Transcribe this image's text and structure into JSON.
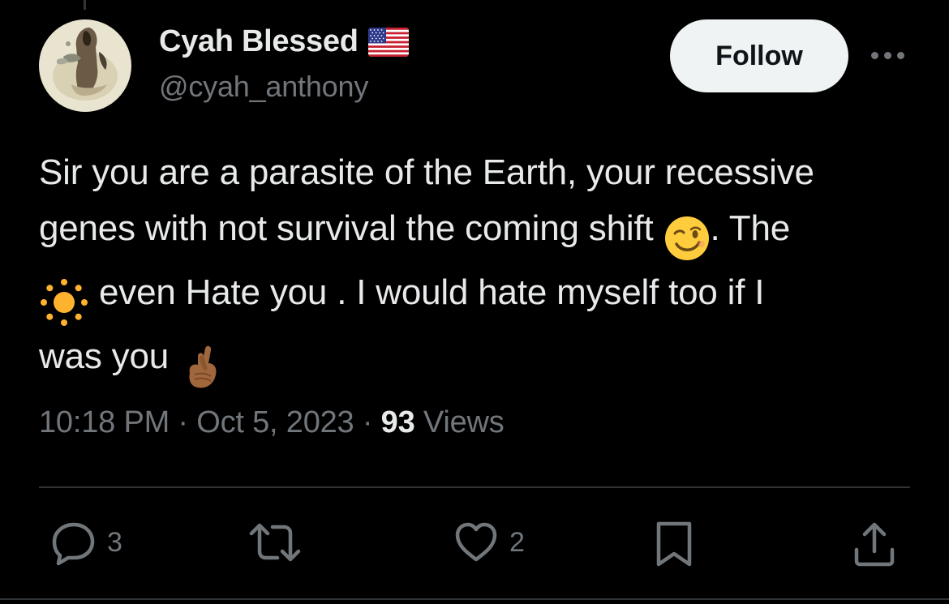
{
  "author": {
    "display_name": "Cyah Blessed",
    "handle": "@cyah_anthony",
    "flag": "us-flag-icon"
  },
  "header": {
    "follow_label": "Follow",
    "more_icon": "more-horizontal-icon"
  },
  "tweet": {
    "line1": "Sir you are a parasite of the Earth, your recessive",
    "line2_a": "genes with not survival the coming shift",
    "line2_b": ". The",
    "line3": " even Hate you . I would hate myself too if I",
    "line4": "was you",
    "emojis": [
      "winking-face-emoji",
      "sun-emoji",
      "crossed-fingers-emoji"
    ]
  },
  "meta": {
    "time": "10:18 PM",
    "sep1": " · ",
    "date": "Oct 5, 2023",
    "sep2": " · ",
    "views_count": "93",
    "views_label": " Views"
  },
  "actions": {
    "reply_count": "3",
    "retweet_count": "",
    "like_count": "2"
  },
  "colors": {
    "background": "#000000",
    "text_primary": "#e7e9ea",
    "text_secondary": "#71767b",
    "follow_bg": "#eff3f4",
    "divider": "#2f3336"
  }
}
